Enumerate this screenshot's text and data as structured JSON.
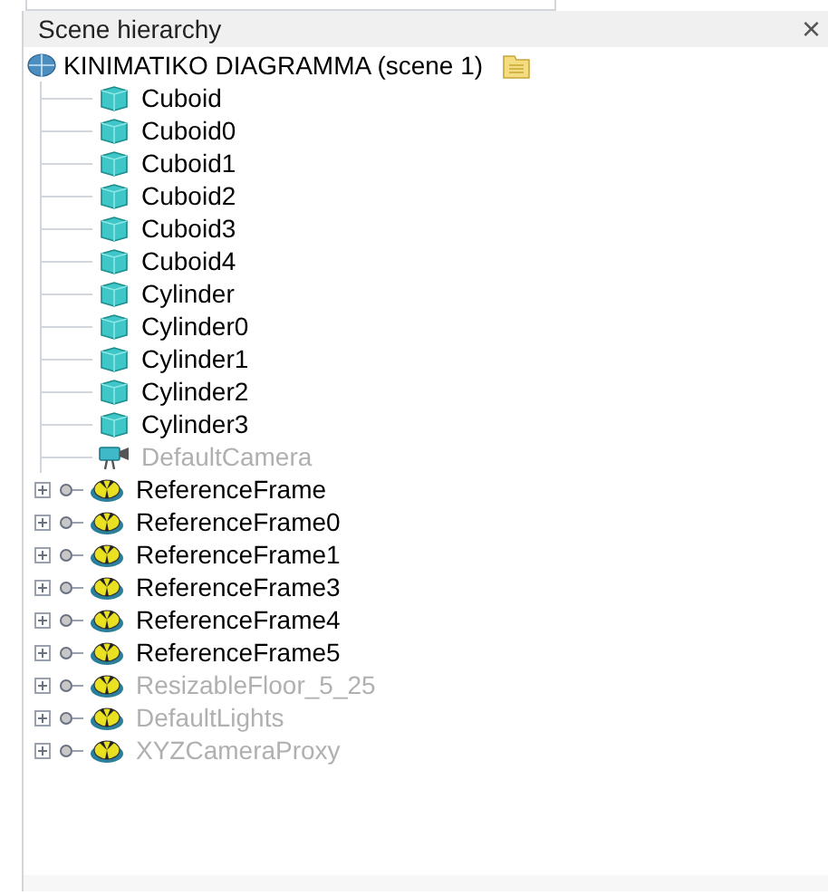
{
  "panel": {
    "title": "Scene hierarchy",
    "close": "×"
  },
  "root": {
    "label": "KINIMATIKO DIAGRAMMA (scene 1)",
    "children": [
      {
        "label": "Cuboid",
        "kind": "shape",
        "disabled": false
      },
      {
        "label": "Cuboid0",
        "kind": "shape",
        "disabled": false
      },
      {
        "label": "Cuboid1",
        "kind": "shape",
        "disabled": false
      },
      {
        "label": "Cuboid2",
        "kind": "shape",
        "disabled": false
      },
      {
        "label": "Cuboid3",
        "kind": "shape",
        "disabled": false
      },
      {
        "label": "Cuboid4",
        "kind": "shape",
        "disabled": false
      },
      {
        "label": "Cylinder",
        "kind": "shape",
        "disabled": false
      },
      {
        "label": "Cylinder0",
        "kind": "shape",
        "disabled": false
      },
      {
        "label": "Cylinder1",
        "kind": "shape",
        "disabled": false
      },
      {
        "label": "Cylinder2",
        "kind": "shape",
        "disabled": false
      },
      {
        "label": "Cylinder3",
        "kind": "shape",
        "disabled": false
      },
      {
        "label": "DefaultCamera",
        "kind": "camera",
        "disabled": true
      }
    ]
  },
  "items": [
    {
      "label": "ReferenceFrame",
      "expanded": false,
      "disabled": false
    },
    {
      "label": "ReferenceFrame0",
      "expanded": false,
      "disabled": false
    },
    {
      "label": "ReferenceFrame1",
      "expanded": false,
      "disabled": false
    },
    {
      "label": "ReferenceFrame3",
      "expanded": false,
      "disabled": false
    },
    {
      "label": "ReferenceFrame4",
      "expanded": false,
      "disabled": false
    },
    {
      "label": "ReferenceFrame5",
      "expanded": false,
      "disabled": false
    },
    {
      "label": "ResizableFloor_5_25",
      "expanded": false,
      "disabled": true
    },
    {
      "label": "DefaultLights",
      "expanded": false,
      "disabled": true
    },
    {
      "label": "XYZCameraProxy",
      "expanded": false,
      "disabled": true
    }
  ]
}
